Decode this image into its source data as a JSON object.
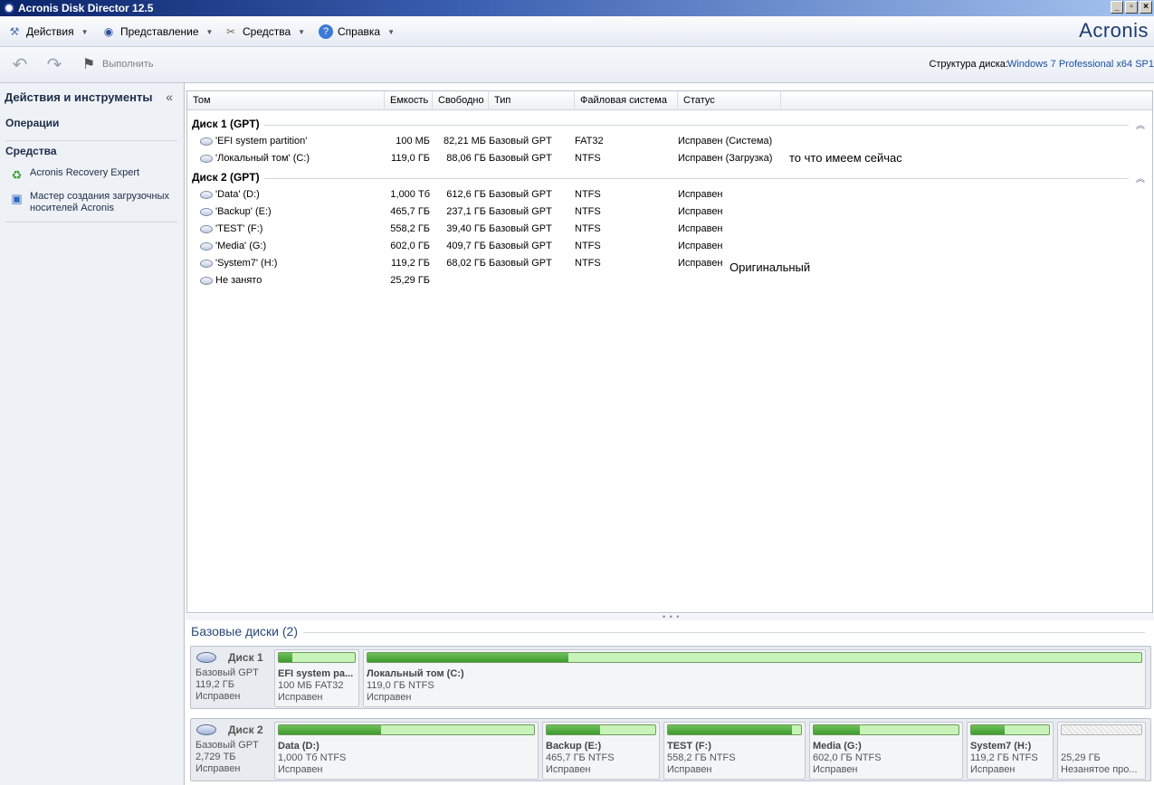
{
  "window": {
    "title": "Acronis Disk Director 12.5"
  },
  "menu": [
    {
      "label": "Действия",
      "icon": "actions-icon"
    },
    {
      "label": "Представление",
      "icon": "eye-icon"
    },
    {
      "label": "Средства",
      "icon": "tools-icon"
    },
    {
      "label": "Справка",
      "icon": "help-icon"
    }
  ],
  "brand": "Acronis",
  "toolbar": {
    "execute_label": "Выполнить",
    "disk_structure_label": "Структура диска:",
    "disk_structure_value": "Windows 7 Professional x64 SP1"
  },
  "sidebar": {
    "title": "Действия и инструменты",
    "collapse_glyph": "«",
    "operations_label": "Операции",
    "tools_label": "Средства",
    "items": [
      {
        "label": "Acronis Recovery Expert",
        "icon": "recovery-icon"
      },
      {
        "label": "Мастер создания загрузочных носителей Acronis",
        "icon": "media-builder-icon"
      }
    ]
  },
  "table": {
    "columns": [
      "Том",
      "Емкость",
      "Свободно",
      "Тип",
      "Файловая система",
      "Статус"
    ],
    "groups": [
      {
        "name": "Диск 1 (GPT)",
        "rows": [
          {
            "volume": "'EFI system partition'",
            "capacity": "100 МБ",
            "free": "82,21 МБ",
            "type": "Базовый GPT",
            "fs": "FAT32",
            "status": "Исправен (Система)"
          },
          {
            "volume": "'Локальный том' (C:)",
            "capacity": "119,0 ГБ",
            "free": "88,06 ГБ",
            "type": "Базовый GPT",
            "fs": "NTFS",
            "status": "Исправен (Загрузка)"
          }
        ]
      },
      {
        "name": "Диск 2 (GPT)",
        "rows": [
          {
            "volume": "'Data' (D:)",
            "capacity": "1,000 Тб",
            "free": "612,6 ГБ",
            "type": "Базовый GPT",
            "fs": "NTFS",
            "status": "Исправен"
          },
          {
            "volume": "'Backup' (E:)",
            "capacity": "465,7 ГБ",
            "free": "237,1 ГБ",
            "type": "Базовый GPT",
            "fs": "NTFS",
            "status": "Исправен"
          },
          {
            "volume": "'TEST' (F:)",
            "capacity": "558,2 ГБ",
            "free": "39,40 ГБ",
            "type": "Базовый GPT",
            "fs": "NTFS",
            "status": "Исправен"
          },
          {
            "volume": "'Media' (G:)",
            "capacity": "602,0 ГБ",
            "free": "409,7 ГБ",
            "type": "Базовый GPT",
            "fs": "NTFS",
            "status": "Исправен"
          },
          {
            "volume": "'System7' (H:)",
            "capacity": "119,2 ГБ",
            "free": "68,02 ГБ",
            "type": "Базовый GPT",
            "fs": "NTFS",
            "status": "Исправен"
          },
          {
            "volume": "Не занято",
            "capacity": "25,29 ГБ",
            "free": "",
            "type": "",
            "fs": "",
            "status": ""
          }
        ]
      }
    ],
    "annotations": [
      "то что имеем сейчас",
      "Оригинальный"
    ]
  },
  "basic_disks": {
    "title": "Базовые диски (2)",
    "disks": [
      {
        "name": "Диск 1",
        "type": "Базовый GPT",
        "size": "119,2 ГБ",
        "status": "Исправен",
        "partitions": [
          {
            "name": "EFI system pa...",
            "info": "100 МБ FAT32",
            "status": "Исправен",
            "used_fraction": 0.18
          },
          {
            "name": "Локальный том (C:)",
            "info": "119,0 ГБ NTFS",
            "status": "Исправен",
            "used_fraction": 0.26
          }
        ]
      },
      {
        "name": "Диск 2",
        "type": "Базовый GPT",
        "size": "2,729 ТБ",
        "status": "Исправен",
        "partitions": [
          {
            "name": "Data (D:)",
            "info": "1,000 Тб NTFS",
            "status": "Исправен",
            "used_fraction": 0.4
          },
          {
            "name": "Backup (E:)",
            "info": "465,7 ГБ NTFS",
            "status": "Исправен",
            "used_fraction": 0.49
          },
          {
            "name": "TEST (F:)",
            "info": "558,2 ГБ NTFS",
            "status": "Исправен",
            "used_fraction": 0.93
          },
          {
            "name": "Media (G:)",
            "info": "602,0 ГБ NTFS",
            "status": "Исправен",
            "used_fraction": 0.32
          },
          {
            "name": "System7 (H:)",
            "info": "119,2 ГБ NTFS",
            "status": "Исправен",
            "used_fraction": 0.43
          },
          {
            "name": "",
            "info": "25,29 ГБ",
            "status": "Незанятое про...",
            "used_fraction": 0
          }
        ]
      }
    ]
  },
  "colors": {
    "accent": "#1f3b73",
    "link": "#1b4fa3",
    "bar_fill": "#3e9a2e",
    "bar_free": "#c8f3b8"
  }
}
